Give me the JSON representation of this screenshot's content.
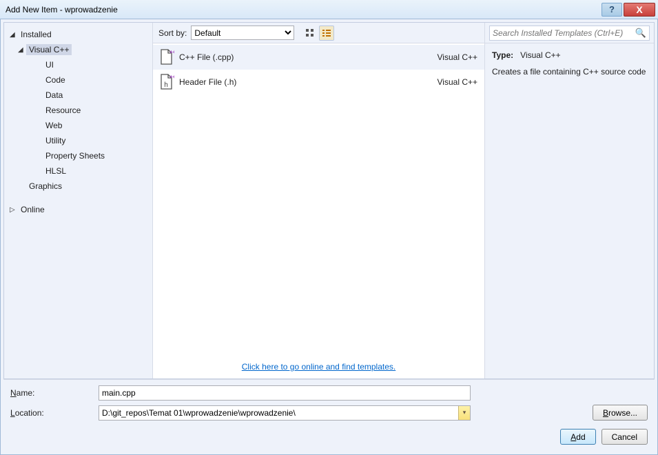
{
  "window": {
    "title": "Add New Item - wprowadzenie",
    "help": "?",
    "close": "X"
  },
  "sidebar": {
    "items": [
      {
        "label": "Installed",
        "level": 0,
        "arrow": "◢",
        "selected": false
      },
      {
        "label": "Visual C++",
        "level": 1,
        "arrow": "◢",
        "selected": true
      },
      {
        "label": "UI",
        "level": 2,
        "arrow": "",
        "selected": false
      },
      {
        "label": "Code",
        "level": 2,
        "arrow": "",
        "selected": false
      },
      {
        "label": "Data",
        "level": 2,
        "arrow": "",
        "selected": false
      },
      {
        "label": "Resource",
        "level": 2,
        "arrow": "",
        "selected": false
      },
      {
        "label": "Web",
        "level": 2,
        "arrow": "",
        "selected": false
      },
      {
        "label": "Utility",
        "level": 2,
        "arrow": "",
        "selected": false
      },
      {
        "label": "Property Sheets",
        "level": 2,
        "arrow": "",
        "selected": false
      },
      {
        "label": "HLSL",
        "level": 2,
        "arrow": "",
        "selected": false
      },
      {
        "label": "Graphics",
        "level": 1,
        "arrow": "",
        "selected": false
      },
      {
        "label": "Online",
        "level": 0,
        "arrow": "▷",
        "selected": false
      }
    ]
  },
  "toolbar": {
    "sort_label": "Sort by:",
    "sort_value": "Default"
  },
  "templates": [
    {
      "name": "C++ File (.cpp)",
      "lang": "Visual C++",
      "selected": true,
      "icon": "cpp"
    },
    {
      "name": "Header File (.h)",
      "lang": "Visual C++",
      "selected": false,
      "icon": "h"
    }
  ],
  "online_link": "Click here to go online and find templates.",
  "search": {
    "placeholder": "Search Installed Templates (Ctrl+E)"
  },
  "info": {
    "type_label": "Type:",
    "type_value": "Visual C++",
    "description": "Creates a file containing C++ source code"
  },
  "form": {
    "name_label_u": "N",
    "name_label_rest": "ame:",
    "name_value": "main.cpp",
    "location_label_u": "L",
    "location_label_rest": "ocation:",
    "location_value": "D:\\git_repos\\Temat 01\\wprowadzenie\\wprowadzenie\\",
    "browse_u": "B",
    "browse_rest": "rowse..."
  },
  "buttons": {
    "add_u": "A",
    "add_rest": "dd",
    "cancel": "Cancel"
  }
}
